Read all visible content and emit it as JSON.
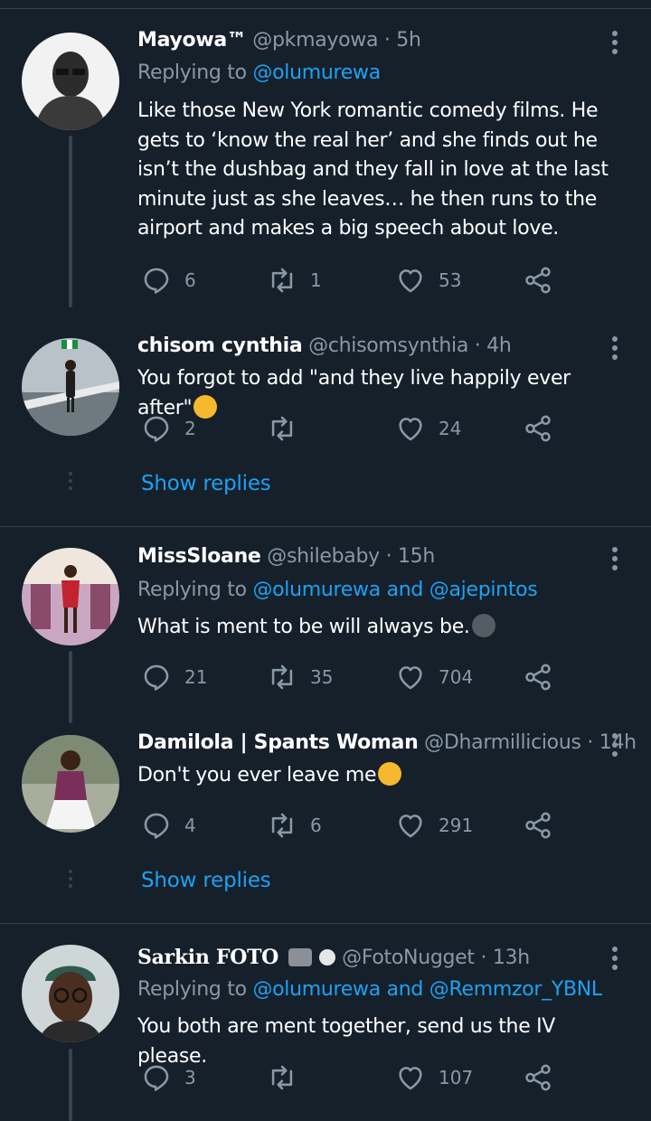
{
  "tweets": [
    {
      "name": "Mayowa™",
      "handle": "@pkmayowa",
      "dot": "·",
      "time": "5h",
      "replying_label": "Replying to",
      "replying_to": "@olumurewa",
      "text": "Like those New York romantic comedy films. He gets to ‘know the real her’ and she finds out he isn’t the dushbag and they fall in love at the last minute just as she leaves… he then runs to the airport and makes a big speech about love.",
      "replies": "6",
      "retweets": "1",
      "likes": "53"
    },
    {
      "name": "chisom cynthia",
      "handle": "@chisomsynthia",
      "dot": "·",
      "time": "4h",
      "text": "You forgot to add \"and they live happily ever after\"",
      "emoji": "rolling-on-floor-laughing-emoji",
      "replies": "2",
      "retweets": "",
      "likes": "24",
      "show_replies": "Show replies"
    },
    {
      "name": "MissSloane",
      "handle": "@shilebaby",
      "dot": "·",
      "time": "15h",
      "replying_label": "Replying to",
      "replying_to": "@olumurewa and @ajepintos",
      "text": "What is ment to be will always be.",
      "emoji": "slightly-smiling-face-emoji",
      "replies": "21",
      "retweets": "35",
      "likes": "704"
    },
    {
      "name": "Damilola | Spants Woman",
      "handle": "@Dharmillicious",
      "dot": "·",
      "time": "14h",
      "text": "Don't you ever leave me",
      "emoji": "tears-of-joy-emoji",
      "replies": "4",
      "retweets": "6",
      "likes": "291",
      "show_replies": "Show replies"
    },
    {
      "name": "Sarkin FOTO",
      "name_decorations": "camera-flash-emoji, flower-badge-icon",
      "handle": "@FotoNugget",
      "dot": "·",
      "time": "13h",
      "replying_label": "Replying to",
      "replying_to": "@olumurewa and @Remmzor_YBNL",
      "text": "You both are ment together, send us the IV please.",
      "replies": "3",
      "retweets": "",
      "likes": "107"
    }
  ],
  "colors": {
    "background": "#15202b",
    "divider": "#38444d",
    "secondary_text": "#8899a6",
    "link": "#1da1f2",
    "primary_text": "#ffffff"
  }
}
